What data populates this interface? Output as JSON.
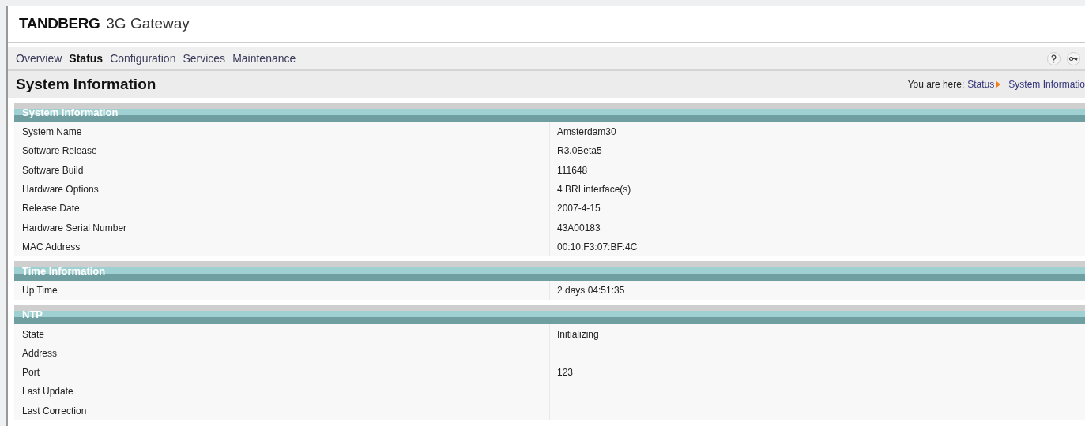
{
  "header": {
    "brand": "TANDBERG",
    "product": "3G Gateway"
  },
  "nav": [
    {
      "label": "Overview",
      "selected": false
    },
    {
      "label": "Status",
      "selected": true
    },
    {
      "label": "Configuration",
      "selected": false
    },
    {
      "label": "Services",
      "selected": false
    },
    {
      "label": "Maintenance",
      "selected": false
    }
  ],
  "page_title": "System Information",
  "breadcrumb": {
    "prefix": "You are here:",
    "items": [
      "Status",
      "System Informatio"
    ]
  },
  "sections": [
    {
      "title": "System Information",
      "rows": [
        {
          "label": "System Name",
          "value": "Amsterdam30"
        },
        {
          "label": "Software Release",
          "value": "R3.0Beta5"
        },
        {
          "label": "Software Build",
          "value": "111648"
        },
        {
          "label": "Hardware Options",
          "value": "4 BRI interface(s)"
        },
        {
          "label": "Release Date",
          "value": "2007-4-15"
        },
        {
          "label": "Hardware Serial Number",
          "value": "43A00183"
        },
        {
          "label": "MAC Address",
          "value": "00:10:F3:07:BF:4C"
        }
      ]
    },
    {
      "title": "Time Information",
      "rows": [
        {
          "label": "Up Time",
          "value": "2 days 04:51:35"
        }
      ]
    },
    {
      "title": "NTP",
      "rows": [
        {
          "label": "State",
          "value": "Initializing"
        },
        {
          "label": "Address"
        },
        {
          "label": "Port",
          "value": "123"
        },
        {
          "label": "Last Update"
        },
        {
          "label": "Last Correction"
        }
      ]
    }
  ]
}
